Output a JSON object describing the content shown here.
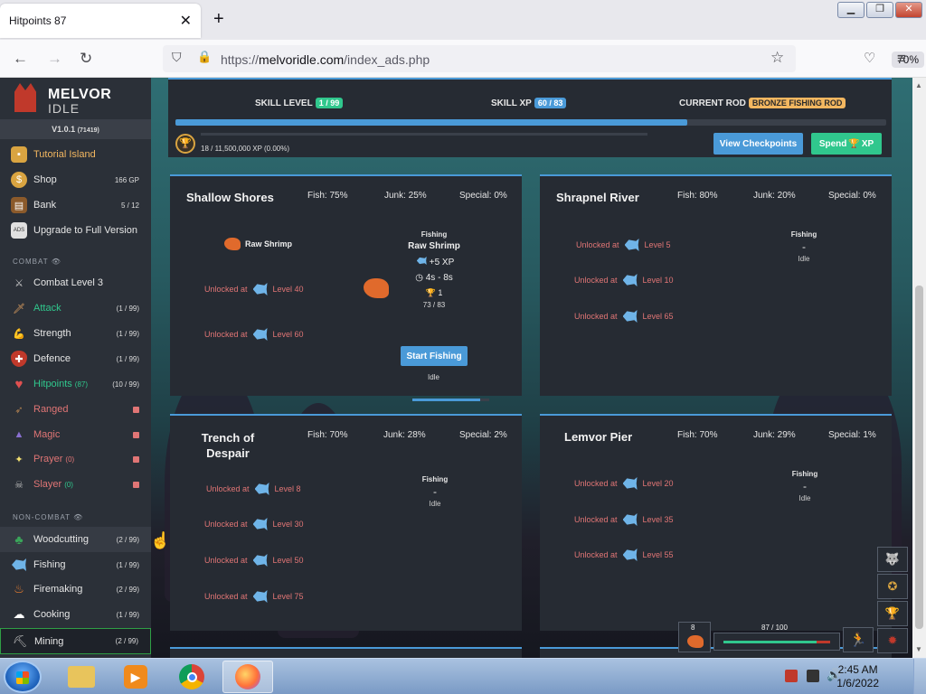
{
  "browser": {
    "tab_title": "Hitpoints 87",
    "url_domain": "melvoridle.com",
    "url_prefix": "https://",
    "url_path": "/index_ads.php",
    "zoom": "70%"
  },
  "logo": {
    "line1": "MELVOR",
    "line2": "IDLE"
  },
  "version": {
    "label": "V1.0.1",
    "build": "(71419)"
  },
  "sidebar": {
    "top_items": [
      {
        "label": "Tutorial Island",
        "extra": ""
      },
      {
        "label": "Shop",
        "extra": "166 GP"
      },
      {
        "label": "Bank",
        "extra": "5 / 12"
      },
      {
        "label": "Upgrade to Full Version",
        "extra": ""
      }
    ],
    "combat_header": "COMBAT",
    "combat_items": [
      {
        "label": "Combat Level 3",
        "extra": ""
      },
      {
        "label": "Attack",
        "extra": "(1 / 99)"
      },
      {
        "label": "Strength",
        "extra": "(1 / 99)"
      },
      {
        "label": "Defence",
        "extra": "(1 / 99)"
      },
      {
        "label": "Hitpoints",
        "sub": "(87)",
        "extra": "(10 / 99)"
      },
      {
        "label": "Ranged",
        "extra": ""
      },
      {
        "label": "Magic",
        "extra": ""
      },
      {
        "label": "Prayer",
        "sub": "(0)",
        "extra": ""
      },
      {
        "label": "Slayer",
        "sub": "(0)",
        "extra": ""
      }
    ],
    "noncombat_header": "NON-COMBAT",
    "noncombat_items": [
      {
        "label": "Woodcutting",
        "extra": "(2 / 99)"
      },
      {
        "label": "Fishing",
        "extra": "(1 / 99)"
      },
      {
        "label": "Firemaking",
        "extra": "(2 / 99)"
      },
      {
        "label": "Cooking",
        "extra": "(1 / 99)"
      },
      {
        "label": "Mining",
        "extra": "(2 / 99)"
      }
    ]
  },
  "skill": {
    "level_label": "SKILL LEVEL",
    "level_value": "1 / 99",
    "xp_label": "SKILL XP",
    "xp_value": "60 / 83",
    "rod_label": "CURRENT ROD",
    "rod_value": "BRONZE FISHING ROD",
    "level_progress": 0.72,
    "mastery_text": "18 / 11,500,000 XP (0.00%)",
    "view_checkpoints": "View Checkpoints",
    "spend_label": "Spend",
    "spend_suffix": "XP"
  },
  "areas": [
    {
      "name": "Shallow Shores",
      "fish": "Fish: 75%",
      "junk": "Junk: 25%",
      "special": "Special: 0%",
      "first_fish": "Raw Shrimp",
      "unlocks": [
        {
          "text": "Unlocked at",
          "level": "Level 40"
        },
        {
          "text": "Unlocked at",
          "level": "Level 60"
        }
      ],
      "info_header": "Fishing",
      "info_fish": "Raw Shrimp",
      "xp": "+5 XP",
      "time": "4s - 8s",
      "mastery": "1",
      "mastery_xp": "73 / 83",
      "mastery_progress": 0.88,
      "start_button": "Start Fishing",
      "status": "Idle"
    },
    {
      "name": "Shrapnel River",
      "fish": "Fish: 80%",
      "junk": "Junk: 20%",
      "special": "Special: 0%",
      "unlocks": [
        {
          "text": "Unlocked at",
          "level": "Level 5"
        },
        {
          "text": "Unlocked at",
          "level": "Level 10"
        },
        {
          "text": "Unlocked at",
          "level": "Level 65"
        }
      ],
      "info_header": "Fishing",
      "dash": "-",
      "status": "Idle"
    },
    {
      "name": "Trench of Despair",
      "fish": "Fish: 70%",
      "junk": "Junk: 28%",
      "special": "Special: 2%",
      "unlocks": [
        {
          "text": "Unlocked at",
          "level": "Level 8"
        },
        {
          "text": "Unlocked at",
          "level": "Level 30"
        },
        {
          "text": "Unlocked at",
          "level": "Level 50"
        },
        {
          "text": "Unlocked at",
          "level": "Level 75"
        }
      ],
      "info_header": "Fishing",
      "dash": "-",
      "status": "Idle"
    },
    {
      "name": "Lemvor Pier",
      "fish": "Fish: 70%",
      "junk": "Junk: 29%",
      "special": "Special: 1%",
      "unlocks": [
        {
          "text": "Unlocked at",
          "level": "Level 20"
        },
        {
          "text": "Unlocked at",
          "level": "Level 35"
        },
        {
          "text": "Unlocked at",
          "level": "Level 55"
        }
      ],
      "info_header": "Fishing",
      "dash": "-",
      "status": "Idle"
    }
  ],
  "hud": {
    "food_count": "8",
    "hp_text": "87 / 100",
    "hp_progress": 0.87
  },
  "taskbar": {
    "time": "2:45 AM",
    "date": "1/6/2022"
  },
  "colors": {
    "accent_blue": "#4a9ad8",
    "accent_green": "#30c78d",
    "locked_red": "#e07575",
    "rod_orange": "#f3b760"
  }
}
